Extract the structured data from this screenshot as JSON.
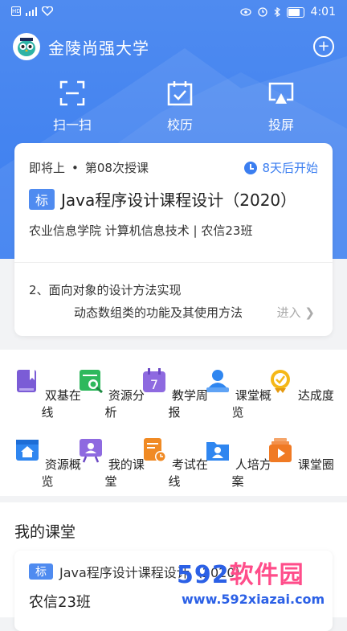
{
  "status_bar": {
    "time": "4:01",
    "signal_text": "HD"
  },
  "header": {
    "title": "金陵尚强大学"
  },
  "quick_actions": [
    {
      "label": "扫一扫",
      "icon": "scan-icon"
    },
    {
      "label": "校历",
      "icon": "calendar-check-icon"
    },
    {
      "label": "投屏",
      "icon": "cast-screen-icon"
    }
  ],
  "upcoming": {
    "status": "即将上",
    "session": "第08次授课",
    "countdown": "8天后开始",
    "tag": "标",
    "course": "Java程序设计课程设计（2020）",
    "dept": "农业信息学院 计算机信息技术 | 农信23班",
    "topic": "2、面向对象的设计方法实现",
    "subtopic": "动态数组类的功能及其使用方法",
    "enter": "进入"
  },
  "grid": [
    {
      "label": "双基在线",
      "icon": "book-icon",
      "color": "#7b5cd6"
    },
    {
      "label": "资源分析",
      "icon": "analysis-icon",
      "color": "#2eb85c"
    },
    {
      "label": "教学周报",
      "icon": "calendar-7-icon",
      "color": "#8e6ae0"
    },
    {
      "label": "课堂概览",
      "icon": "teacher-icon",
      "color": "#2f86f0"
    },
    {
      "label": "达成度",
      "icon": "medal-icon",
      "color": "#f5b818"
    },
    {
      "label": "资源概览",
      "icon": "house-screen-icon",
      "color": "#2f86f0"
    },
    {
      "label": "我的课堂",
      "icon": "presentation-icon",
      "color": "#8e6ae0"
    },
    {
      "label": "考试在线",
      "icon": "exam-clock-icon",
      "color": "#f08a24"
    },
    {
      "label": "人培方案",
      "icon": "folder-person-icon",
      "color": "#2f86f0"
    },
    {
      "label": "课堂圈",
      "icon": "play-stack-icon",
      "color": "#f07a24"
    }
  ],
  "my_class": {
    "heading": "我的课堂",
    "tag": "标",
    "course": "Java程序设计课程设计（2020）",
    "class_name": "农信23班"
  },
  "watermark": {
    "brand_num": "592",
    "brand_cn": "软件园",
    "url": "www.592xiazai.com"
  }
}
